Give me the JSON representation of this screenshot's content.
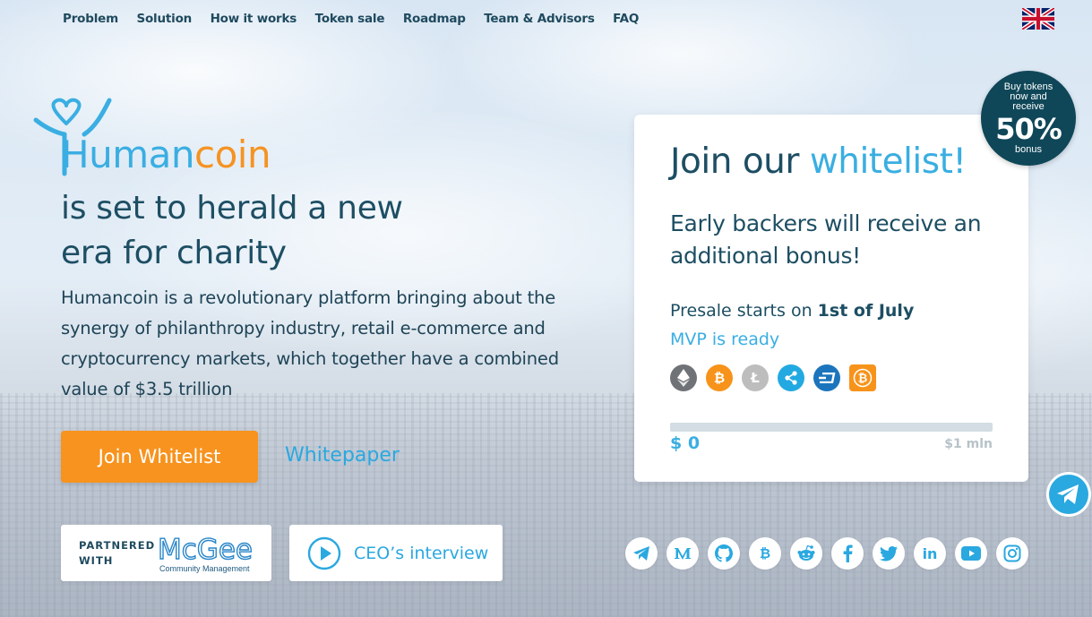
{
  "nav": {
    "items": [
      "Problem",
      "Solution",
      "How it works",
      "Token sale",
      "Roadmap",
      "Team & Advisors",
      "FAQ"
    ]
  },
  "language_flag": "uk-flag-icon",
  "brand": {
    "part1": "Human",
    "part2": "coin",
    "color1": "#3aaee2",
    "color2": "#f59322"
  },
  "hero": {
    "headline_line1": "is set to herald a new",
    "headline_line2": "era for charity",
    "lead": "Humancoin is a revolutionary platform bringing about the synergy of philanthropy industry, retail e-commerce and cryptocurrency markets, which together have a combined value of $3.5 trillion",
    "join_button": "Join Whitelist",
    "whitepaper_link": "Whitepaper"
  },
  "partner": {
    "label_line1": "PARTNERED",
    "label_line2": "WITH",
    "logo_text": "McGee",
    "logo_sub": "Community Management"
  },
  "ceo": {
    "label": "CEO’s interview"
  },
  "whitelist_card": {
    "title_part1": "Join our",
    "title_part2": "whitelist!",
    "subtitle": "Early backers will receive an additional bonus!",
    "presale_prefix": "Presale starts on",
    "presale_date": "1st of July",
    "mvp": "MVP is ready",
    "coins": [
      "ethereum-icon",
      "bitcoin-icon",
      "litecoin-icon",
      "ripple-icon",
      "dash-icon",
      "bitcoin-cash-icon"
    ],
    "progress_fraction": 0,
    "raised": "$ 0",
    "goal": "$1 mln"
  },
  "bonus_badge": {
    "line1": "Buy tokens now and receive",
    "percent": "50%",
    "line3": "bonus"
  },
  "socials": [
    "telegram-icon",
    "medium-icon",
    "github-icon",
    "bitcointalk-icon",
    "reddit-icon",
    "facebook-icon",
    "twitter-icon",
    "linkedin-icon",
    "youtube-icon",
    "instagram-icon"
  ],
  "colors": {
    "accent_blue": "#3aaee2",
    "accent_orange": "#f7931e",
    "dark_teal": "#1d4e63"
  }
}
